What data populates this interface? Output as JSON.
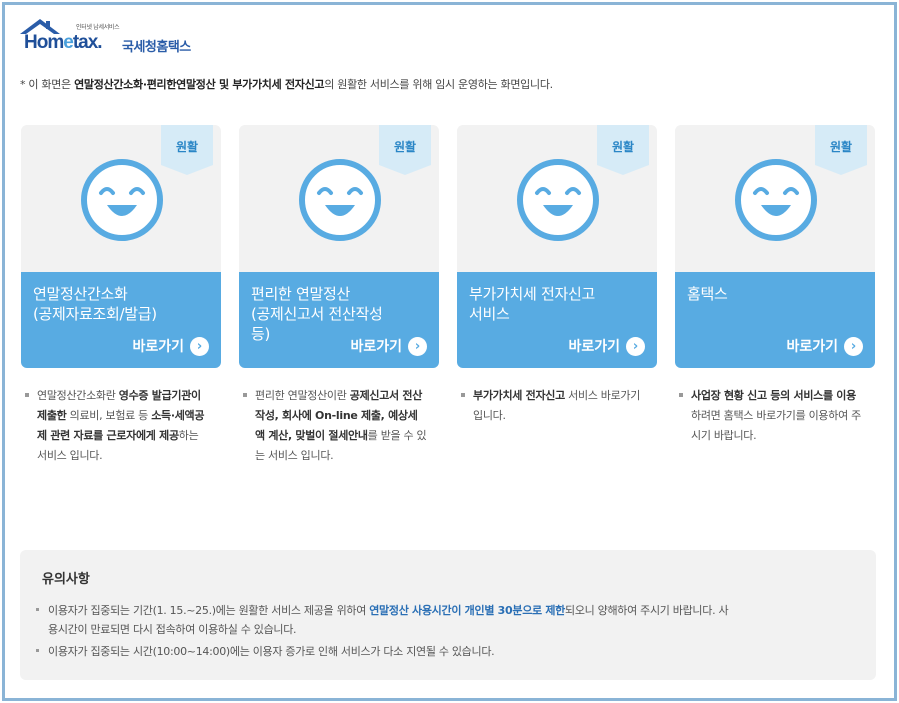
{
  "header": {
    "logo_small": "인터넷 납세서비스",
    "logo_home": "Hom",
    "logo_e": "e",
    "logo_tax": "tax.",
    "logo_kr": "국세청홈택스"
  },
  "notice": {
    "prefix": "* 이 화면은 ",
    "bold": "연말정산간소화·편리한연말정산 및 부가가치세 전자신고",
    "suffix": "의 원활한 서비스를 위해 임시 운영하는 화면입니다."
  },
  "cards": [
    {
      "status": "원활",
      "title": "연말정산간소화\n(공제자료조회/발급)",
      "go_label": "바로가기",
      "desc_html": "연말정산간소화란 <b>영수증 발급기관이 제출한</b> 의료비, 보험료 등 <b>소득·세액공제 관련 자료를 근로자에게 제공</b>하는 서비스 입니다."
    },
    {
      "status": "원활",
      "title": "편리한 연말정산\n(공제신고서 전산작성\n등)",
      "go_label": "바로가기",
      "desc_html": "편리한 연말정산이란 <b>공제신고서 전산작성, 회사에 On-line 제출, 예상세액 계산, 맞벌이 절세안내</b>를 받을 수 있는 서비스 입니다."
    },
    {
      "status": "원활",
      "title": "부가가치세 전자신고\n서비스",
      "go_label": "바로가기",
      "desc_html": "<b>부가가치세 전자신고</b> 서비스 바로가기 입니다."
    },
    {
      "status": "원활",
      "title": "홈택스",
      "go_label": "바로가기",
      "desc_html": "<b>사업장 현황 신고 등의 서비스를 이용</b>하려면 홈택스 바로가기를 이용하여 주시기 바랍니다."
    }
  ],
  "caution": {
    "title": "유의사항",
    "item1_pre": "이용자가 집중되는 기간(1. 15.~25.)에는 원활한 서비스 제공을 위하여 ",
    "item1_bold": "연말정산 사용시간이 개인별 30분으로 제한",
    "item1_post": "되오니 양해하여 주시기 바랍니다. 사용시간이 만료되면 다시 접속하여 이용하실 수 있습니다.",
    "item2": "이용자가 집중되는 시간(10:00~14:00)에는 이용자 증가로 인해 서비스가 다소 지연될 수 있습니다."
  },
  "colors": {
    "accent": "#58abe2",
    "badge_bg": "#d6ebf7",
    "frame": "#8ab4d6"
  }
}
